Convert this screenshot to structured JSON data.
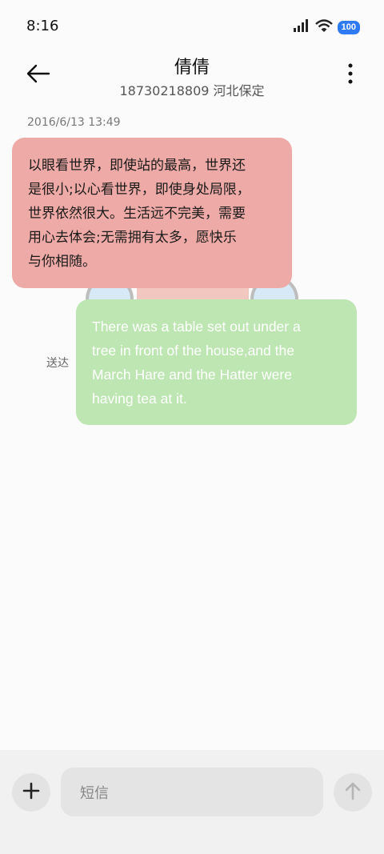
{
  "status_bar": {
    "time": "8:16",
    "battery": "100",
    "icons": [
      "signal-icon",
      "wifi-icon",
      "battery-icon"
    ]
  },
  "header": {
    "contact_name": "倩倩",
    "contact_detail": "18730218809 河北保定",
    "back_icon": "arrow-left-icon",
    "more_icon": "more-vertical-icon"
  },
  "conversation": {
    "timestamp": "2016/6/13 13:49",
    "incoming_lines": [
      "以眼看世界，即使站的最高，世界还",
      "是很小;以心看世界，即使身处局限，",
      "世界依然很大。生活远不完美，需要",
      "用心去体会;无需拥有太多，愿快乐",
      "与你相随。"
    ],
    "outgoing_lines": [
      "There was a table set out under a",
      "tree in front of the house,and the",
      "March Hare and the Hatter were",
      "having tea at it."
    ],
    "delivery_status": "送达"
  },
  "composer": {
    "placeholder": "短信",
    "add_icon": "plus-icon",
    "send_icon": "arrow-up-icon"
  },
  "colors": {
    "incoming_bubble": "#eeaaa6",
    "outgoing_bubble": "#bde6b2",
    "battery_badge": "#2f7bf5"
  }
}
